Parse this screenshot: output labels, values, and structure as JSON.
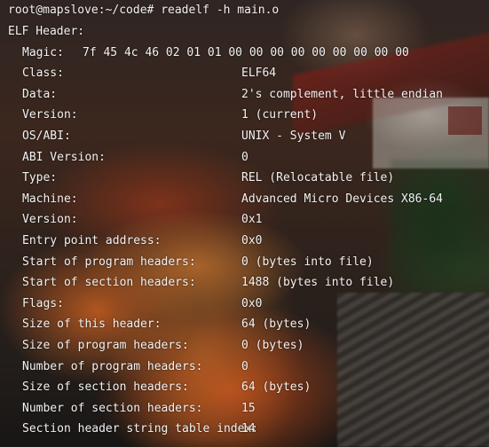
{
  "terminal": {
    "prompt": "root@mapslove:~/code#",
    "command": "readelf -h main.o",
    "header_title": "ELF Header:",
    "magic": {
      "label": "Magic:",
      "value": "7f 45 4c 46 02 01 01 00 00 00 00 00 00 00 00 00"
    },
    "fields": [
      {
        "label": "Class:",
        "value": "ELF64"
      },
      {
        "label": "Data:",
        "value": "2's complement, little endian"
      },
      {
        "label": "Version:",
        "value": "1 (current)"
      },
      {
        "label": "OS/ABI:",
        "value": "UNIX - System V"
      },
      {
        "label": "ABI Version:",
        "value": "0"
      },
      {
        "label": "Type:",
        "value": "REL (Relocatable file)"
      },
      {
        "label": "Machine:",
        "value": "Advanced Micro Devices X86-64"
      },
      {
        "label": "Version:",
        "value": "0x1"
      },
      {
        "label": "Entry point address:",
        "value": "0x0"
      },
      {
        "label": "Start of program headers:",
        "value": "0 (bytes into file)"
      },
      {
        "label": "Start of section headers:",
        "value": "1488 (bytes into file)"
      },
      {
        "label": "Flags:",
        "value": "0x0"
      },
      {
        "label": "Size of this header:",
        "value": "64 (bytes)"
      },
      {
        "label": "Size of program headers:",
        "value": "0 (bytes)"
      },
      {
        "label": "Number of program headers:",
        "value": "0"
      },
      {
        "label": "Size of section headers:",
        "value": "64 (bytes)"
      },
      {
        "label": "Number of section headers:",
        "value": "15"
      },
      {
        "label": "Section header string table index:",
        "value": "14"
      }
    ]
  },
  "colors": {
    "text": "#f2f2f2",
    "wallpaper_warm": "#f05a1e",
    "wallpaper_dark": "#1c1a18"
  }
}
